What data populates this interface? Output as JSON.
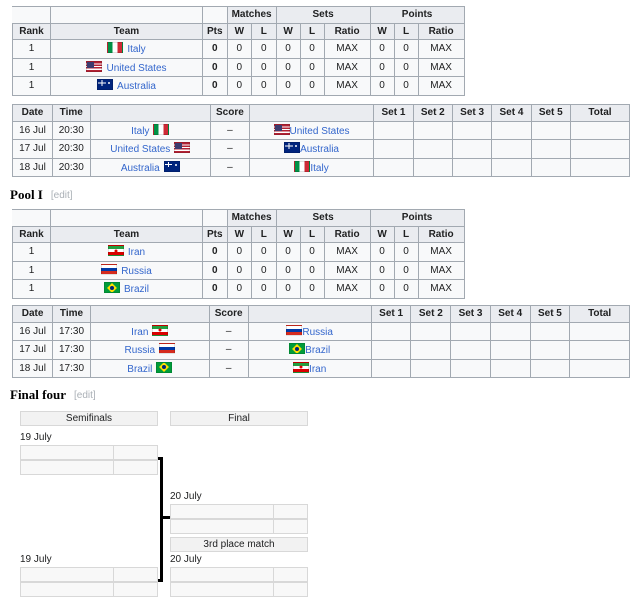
{
  "standings_columns": {
    "rank": "Rank",
    "team": "Team",
    "pts": "Pts",
    "groups": [
      "Matches",
      "Sets",
      "Points"
    ],
    "sub": [
      "W",
      "L",
      "W",
      "L",
      "Ratio",
      "W",
      "L",
      "Ratio"
    ]
  },
  "schedule_columns": {
    "date": "Date",
    "time": "Time",
    "score": "Score",
    "sets": [
      "Set 1",
      "Set 2",
      "Set 3",
      "Set 4",
      "Set 5"
    ],
    "total": "Total"
  },
  "pool_h": {
    "standings": [
      {
        "rank": "1",
        "team": "Italy",
        "flag": "it",
        "pts": "0",
        "mw": "0",
        "ml": "0",
        "sw": "0",
        "sl": "0",
        "sratio": "MAX",
        "pw": "0",
        "pl": "0",
        "pratio": "MAX"
      },
      {
        "rank": "1",
        "team": "United States",
        "flag": "us",
        "pts": "0",
        "mw": "0",
        "ml": "0",
        "sw": "0",
        "sl": "0",
        "sratio": "MAX",
        "pw": "0",
        "pl": "0",
        "pratio": "MAX"
      },
      {
        "rank": "1",
        "team": "Australia",
        "flag": "au",
        "pts": "0",
        "mw": "0",
        "ml": "0",
        "sw": "0",
        "sl": "0",
        "sratio": "MAX",
        "pw": "0",
        "pl": "0",
        "pratio": "MAX"
      }
    ],
    "matches": [
      {
        "date": "16 Jul",
        "time": "20:30",
        "home": "Italy",
        "home_flag": "it",
        "score": "–",
        "away": "United States",
        "away_flag": "us",
        "s1": "",
        "s2": "",
        "s3": "",
        "s4": "",
        "s5": "",
        "total": ""
      },
      {
        "date": "17 Jul",
        "time": "20:30",
        "home": "United States",
        "home_flag": "us",
        "score": "–",
        "away": "Australia",
        "away_flag": "au",
        "s1": "",
        "s2": "",
        "s3": "",
        "s4": "",
        "s5": "",
        "total": ""
      },
      {
        "date": "18 Jul",
        "time": "20:30",
        "home": "Australia",
        "home_flag": "au",
        "score": "–",
        "away": "Italy",
        "away_flag": "it",
        "s1": "",
        "s2": "",
        "s3": "",
        "s4": "",
        "s5": "",
        "total": ""
      }
    ]
  },
  "pool_i": {
    "heading": "Pool I",
    "edit": "[edit]",
    "edit_open": "[",
    "edit_label": "edit",
    "edit_close": "]",
    "standings": [
      {
        "rank": "1",
        "team": "Iran",
        "flag": "ir",
        "pts": "0",
        "mw": "0",
        "ml": "0",
        "sw": "0",
        "sl": "0",
        "sratio": "MAX",
        "pw": "0",
        "pl": "0",
        "pratio": "MAX"
      },
      {
        "rank": "1",
        "team": "Russia",
        "flag": "ru",
        "pts": "0",
        "mw": "0",
        "ml": "0",
        "sw": "0",
        "sl": "0",
        "sratio": "MAX",
        "pw": "0",
        "pl": "0",
        "pratio": "MAX"
      },
      {
        "rank": "1",
        "team": "Brazil",
        "flag": "br",
        "pts": "0",
        "mw": "0",
        "ml": "0",
        "sw": "0",
        "sl": "0",
        "sratio": "MAX",
        "pw": "0",
        "pl": "0",
        "pratio": "MAX"
      }
    ],
    "matches": [
      {
        "date": "16 Jul",
        "time": "17:30",
        "home": "Iran",
        "home_flag": "ir",
        "score": "–",
        "away": "Russia",
        "away_flag": "ru",
        "s1": "",
        "s2": "",
        "s3": "",
        "s4": "",
        "s5": "",
        "total": ""
      },
      {
        "date": "17 Jul",
        "time": "17:30",
        "home": "Russia",
        "home_flag": "ru",
        "score": "–",
        "away": "Brazil",
        "away_flag": "br",
        "s1": "",
        "s2": "",
        "s3": "",
        "s4": "",
        "s5": "",
        "total": ""
      },
      {
        "date": "18 Jul",
        "time": "17:30",
        "home": "Brazil",
        "home_flag": "br",
        "score": "–",
        "away": "Iran",
        "away_flag": "ir",
        "s1": "",
        "s2": "",
        "s3": "",
        "s4": "",
        "s5": "",
        "total": ""
      }
    ]
  },
  "final_four": {
    "heading": "Final four",
    "edit_open": "[",
    "edit_label": "edit",
    "edit_close": "]",
    "semifinals_header": "Semifinals",
    "final_header": "Final",
    "third_place_header": "3rd place match",
    "semifinal1_date": "19 July",
    "semifinal2_date": "19 July",
    "final_date": "20 July",
    "third_place_date": "20 July",
    "semifinal1": [
      {
        "team": "",
        "score": ""
      },
      {
        "team": "",
        "score": ""
      }
    ],
    "semifinal2": [
      {
        "team": "",
        "score": ""
      },
      {
        "team": "",
        "score": ""
      }
    ],
    "final": [
      {
        "team": "",
        "score": ""
      },
      {
        "team": "",
        "score": ""
      }
    ],
    "third_place": [
      {
        "team": "",
        "score": ""
      },
      {
        "team": "",
        "score": ""
      }
    ]
  }
}
